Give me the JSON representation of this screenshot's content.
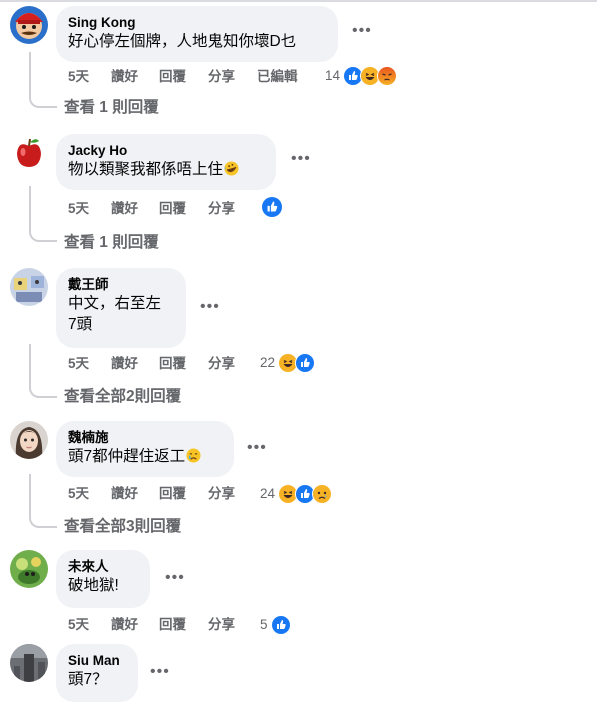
{
  "comments": [
    {
      "name": "Sing Kong",
      "text": "好心停左個牌，人地鬼知你壞D乜",
      "time": "5天",
      "like": "讚好",
      "reply": "回覆",
      "share": "分享",
      "edited": "已編輯",
      "reaction_count": "14",
      "reactions": [
        "like-icon",
        "laugh-icon",
        "angry-icon"
      ],
      "view_replies": "查看 1 則回覆"
    },
    {
      "name": "Jacky Ho",
      "text": "物以類聚我都係唔上住",
      "time": "5天",
      "like": "讚好",
      "reply": "回覆",
      "share": "分享",
      "reaction_count": "",
      "reactions": [
        "like-icon"
      ],
      "view_replies": "查看 1 則回覆"
    },
    {
      "name": "戴王師",
      "text": "中文，右至左\n7頭",
      "time": "5天",
      "like": "讚好",
      "reply": "回覆",
      "share": "分享",
      "reaction_count": "22",
      "reactions": [
        "laugh-icon",
        "like-icon"
      ],
      "view_replies": "查看全部2則回覆"
    },
    {
      "name": "魏楠施",
      "text": "頭7都仲趕住返工",
      "time": "5天",
      "like": "讚好",
      "reply": "回覆",
      "share": "分享",
      "reaction_count": "24",
      "reactions": [
        "laugh-icon",
        "like-icon",
        "sad-icon"
      ],
      "view_replies": "查看全部3則回覆"
    },
    {
      "name": "未來人",
      "text": "破地獄!",
      "time": "5天",
      "like": "讚好",
      "reply": "回覆",
      "share": "分享",
      "reaction_count": "5",
      "reactions": [
        "like-icon"
      ]
    },
    {
      "name": "Siu Man",
      "text": "頭7？"
    }
  ],
  "more_icon": "more-options-icon",
  "colors": {
    "bubble": "#f0f2f5",
    "meta_text": "#65676b",
    "like_blue": "#1877f2",
    "thread_line": "#ced0d4"
  }
}
